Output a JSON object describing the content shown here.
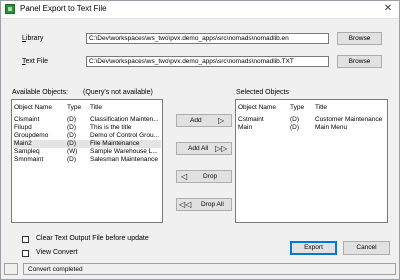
{
  "window": {
    "title": "Panel Export to Text File",
    "close_glyph": "✕"
  },
  "library": {
    "label": "Library",
    "value": "C:\\Dev\\workspaces\\ws_two\\pvx.demo_apps\\src\\nomads\\nomadlib.en",
    "browse_label": "Browse"
  },
  "text_file": {
    "label": "Text File",
    "value": "C:\\Dev\\workspaces\\ws_two\\pvx.demo_apps\\src\\nomads\\nomadlib.TXT",
    "browse_label": "Browse"
  },
  "available": {
    "label": "Available Objects:",
    "note": "(Query's not available)",
    "columns": [
      "Object Name",
      "Type",
      "Title"
    ],
    "rows": [
      {
        "name": "Clsmaint",
        "type": "(D)",
        "title": "Classification Mainten..."
      },
      {
        "name": "Filupd",
        "type": "(D)",
        "title": "This is the title"
      },
      {
        "name": "Groupdemo",
        "type": "(D)",
        "title": "Demo of Control Grou..."
      },
      {
        "name": "Main2",
        "type": "(D)",
        "title": "File Maintenance"
      },
      {
        "name": "Sampleq",
        "type": "(W)",
        "title": "Sample Warehouse L..."
      },
      {
        "name": "Smnmaint",
        "type": "(D)",
        "title": "Salesman Maintenance"
      }
    ]
  },
  "selected": {
    "label": "Selected Objects",
    "columns": [
      "Object Name",
      "Type",
      "Title"
    ],
    "rows": [
      {
        "name": "Cstmaint",
        "type": "(D)",
        "title": "Customer Maintenance"
      },
      {
        "name": "Main",
        "type": "(D)",
        "title": "Main Menu"
      }
    ]
  },
  "move_buttons": {
    "add": {
      "label": "Add",
      "icon": "arrow-right-icon"
    },
    "add_all": {
      "label": "Add All",
      "icon": "double-arrow-right-icon"
    },
    "drop": {
      "label": "Drop",
      "icon": "arrow-left-icon"
    },
    "drop_all": {
      "label": "Drop All",
      "icon": "double-arrow-left-icon"
    }
  },
  "options": {
    "clear_text_output": {
      "label": "Clear Text Output File before update",
      "checked": false
    },
    "view_convert": {
      "label": "View Convert",
      "checked": false
    }
  },
  "actions": {
    "export_label": "Export",
    "cancel_label": "Cancel"
  },
  "status": {
    "text": "Convert completed"
  }
}
